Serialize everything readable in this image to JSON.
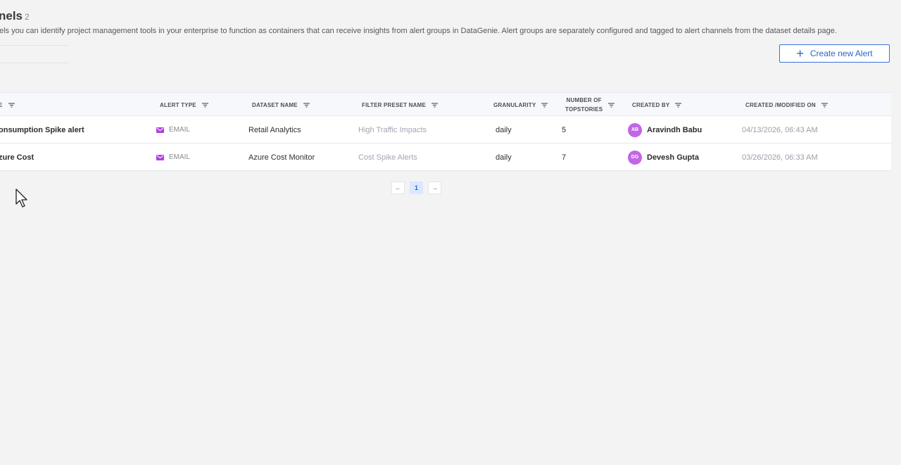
{
  "header": {
    "title": "nels",
    "count": "2",
    "description": "els you can identify project management tools in your enterprise to function as containers that can receive insights from alert groups in DataGenie. Alert groups are separately configured and tagged to alert channels from the dataset details page."
  },
  "toolbar": {
    "create_label": "Create new Alert"
  },
  "table": {
    "headers": {
      "name": "E",
      "alert_type": "ALERT TYPE",
      "dataset_name": "DATASET NAME",
      "filter_preset": "FILTER PRESET NAME",
      "granularity": "GRANULARITY",
      "topstories_line1": "NUMBER OF",
      "topstories_line2": "TOPSTORIES",
      "created_by": "CREATED BY",
      "created_on": "CREATED /MODIFIED ON"
    },
    "rows": [
      {
        "name": "onsumption Spike alert",
        "alert_type": "EMAIL",
        "dataset": "Retail Analytics",
        "preset": "High Traffic Impacts",
        "granularity": "daily",
        "topstories": "5",
        "initials": "AB",
        "creator": "Aravindh Babu",
        "date": "04/13/2026, 06:43 AM"
      },
      {
        "name": "zure Cost",
        "alert_type": "EMAIL",
        "dataset": "Azure Cost Monitor",
        "preset": "Cost Spike Alerts",
        "granularity": "daily",
        "topstories": "7",
        "initials": "DG",
        "creator": "Devesh Gupta",
        "date": "03/26/2026, 06:33 AM"
      }
    ]
  },
  "pagination": {
    "prev": "←",
    "current": "1",
    "next": "→"
  },
  "colors": {
    "accent": "#2d64cc",
    "avatar": "#c266e6",
    "email_icon": "#b040e0"
  }
}
